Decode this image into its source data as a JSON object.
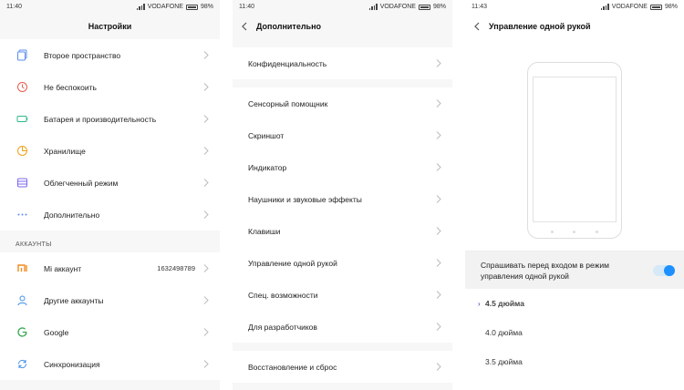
{
  "screens": [
    {
      "status": {
        "time": "11:40",
        "carrier": "VODAFONE",
        "battery": "98%"
      },
      "title": "Настройки",
      "items": [
        {
          "label": "Второе пространство",
          "icon": "dual-space-icon",
          "color": "#5b8def"
        },
        {
          "label": "Не беспокоить",
          "icon": "moon-icon",
          "color": "#e65a4f"
        },
        {
          "label": "Батарея и производительность",
          "icon": "battery-icon",
          "color": "#2fb88a"
        },
        {
          "label": "Хранилище",
          "icon": "storage-icon",
          "color": "#f0a21a"
        },
        {
          "label": "Облегченный режим",
          "icon": "lite-mode-icon",
          "color": "#7b68ee"
        },
        {
          "label": "Дополнительно",
          "icon": "more-dots-icon",
          "color": "#5b8def"
        }
      ],
      "accounts_header": "АККАУНТЫ",
      "accounts": [
        {
          "label": "Mi аккаунт",
          "value": "1632498789",
          "icon": "mi-logo-icon",
          "color": "#f28a1d"
        },
        {
          "label": "Другие аккаунты",
          "value": "",
          "icon": "user-icon",
          "color": "#3d8fe8"
        },
        {
          "label": "Google",
          "value": "",
          "icon": "google-g-icon",
          "color": "#34a853"
        },
        {
          "label": "Синхронизация",
          "value": "",
          "icon": "sync-icon",
          "color": "#3d8fe8"
        }
      ]
    },
    {
      "status": {
        "time": "11:40",
        "carrier": "VODAFONE",
        "battery": "98%"
      },
      "title": "Дополнительно",
      "group1": [
        "Конфиденциальность"
      ],
      "group2": [
        "Сенсорный помощник",
        "Скриншот",
        "Индикатор",
        "Наушники и звуковые эффекты",
        "Клавиши",
        "Управление одной рукой",
        "Спец. возможности",
        "Для разработчиков"
      ],
      "group3": [
        "Восстановление и сброс"
      ]
    },
    {
      "status": {
        "time": "11:43",
        "carrier": "VODAFONE",
        "battery": "98%"
      },
      "title": "Управление одной рукой",
      "toggle_label": "Спрашивать перед входом в режим управления одной рукой",
      "toggle_on": true,
      "options": [
        {
          "label": "4.5 дюйма",
          "selected": true
        },
        {
          "label": "4.0 дюйма",
          "selected": false
        },
        {
          "label": "3.5 дюйма",
          "selected": false
        }
      ],
      "accent": "#1e90ff"
    }
  ]
}
